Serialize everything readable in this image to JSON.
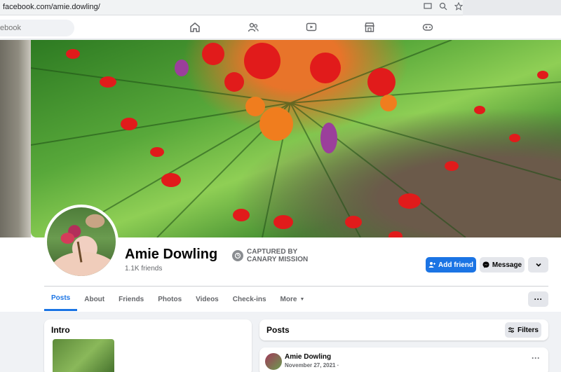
{
  "browser": {
    "url": "facebook.com/amie.dowling/"
  },
  "nav": {
    "search_placeholder": "ebook"
  },
  "profile": {
    "name": "Amie Dowling",
    "friends": "1.1K friends",
    "captured_line1": "CAPTURED BY",
    "captured_line2": "CANARY MISSION"
  },
  "actions": {
    "add_friend": "Add friend",
    "message": "Message"
  },
  "tabs": [
    {
      "label": "Posts"
    },
    {
      "label": "About"
    },
    {
      "label": "Friends"
    },
    {
      "label": "Photos"
    },
    {
      "label": "Videos"
    },
    {
      "label": "Check-ins"
    },
    {
      "label": "More"
    }
  ],
  "intro": {
    "title": "Intro"
  },
  "posts": {
    "title": "Posts",
    "filters": "Filters"
  },
  "post": {
    "author": "Amie Dowling",
    "date": "November 27, 2021 ·"
  },
  "colors": {
    "accent": "#1b74e4",
    "background": "#f0f2f5"
  }
}
